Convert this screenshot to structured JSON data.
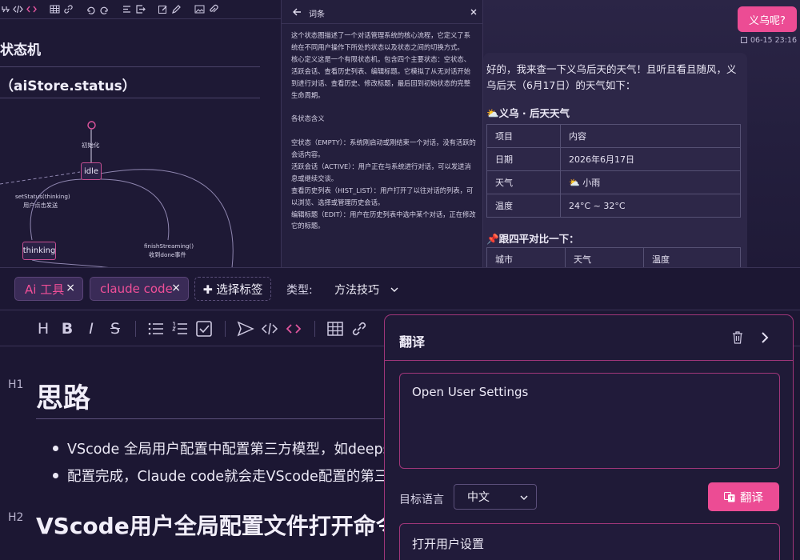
{
  "diagram": {
    "heading1": "状态机",
    "heading2": "（aiStore.status）",
    "nodes": {
      "init_label": "初始化",
      "idle": "idle",
      "thinking": "thinking",
      "edge1_line1": "setStatus(thinking)",
      "edge1_line2": "用户点击发送",
      "edge2_line1": "finishStreaming()",
      "edge2_line2": "收到done事件"
    },
    "toolbar_icons": [
      "code-icon",
      "code-brackets-icon",
      "table-icon",
      "link-icon",
      "undo-icon",
      "redo-icon",
      "align-icon",
      "export-icon",
      "edit-icon",
      "brush-icon",
      "image-icon",
      "attach-icon"
    ]
  },
  "glossary": {
    "title": "词条",
    "paragraphs": [
      "这个状态图描述了一个对话管理系统的核心流程，它定义了系统在不同用户操作下所处的状态以及状态之间的切换方式。",
      "核心定义这是一个有限状态机，包含四个主要状态：空状态、活跃会话、查看历史列表、编辑标题。它模拟了从无对话开始到进行对话、查看历史、修改标题，最后回到初始状态的完整生命周期。",
      "",
      "各状态含义",
      "",
      "空状态（EMPTY）：系统刚启动或刚结束一个对话，没有活跃的会话内容。",
      "活跃会话（ACTIVE）：用户正在与系统进行对话，可以发送消息或继续交谈。",
      "查看历史列表（HIST_LIST）：用户打开了以往对话的列表，可以浏览、选择或管理历史会话。",
      "编辑标题（EDIT）：用户在历史列表中选中某个对话，正在修改它的标题。"
    ]
  },
  "chat": {
    "user_message": "义乌呢?",
    "timestamp": "06-15 23:16",
    "reply_intro": "好的，我来查一下义乌后天的天气！且听且看且随风，义乌后天（6月17日）的天气如下：",
    "weather_heading": "义乌 · 后天天气",
    "weather_table": {
      "header": [
        "项目",
        "内容"
      ],
      "rows": [
        [
          "日期",
          "2026年6月17日"
        ],
        [
          "天气",
          "小雨"
        ],
        [
          "温度",
          "24°C ~ 32°C"
        ]
      ]
    },
    "compare_heading": "跟四平对比一下：",
    "compare_header": [
      "城市",
      "天气",
      "温度"
    ]
  },
  "editor": {
    "tags": [
      "Ai 工具",
      "claude code"
    ],
    "tag_remove": "×",
    "add_tag_label": "✚ 选择标签",
    "type_label": "类型:",
    "type_value": "方法技巧",
    "h1_marker": "H1",
    "h1_text": "思路",
    "bullets": [
      "VScode 全局用户配置中配置第三方模型，如deepseek",
      "配置完成，Claude code就会走VScode配置的第三方模型"
    ],
    "h2_marker": "H2",
    "h2_text": "VScode用户全局配置文件打开命令"
  },
  "translate": {
    "title": "翻译",
    "input_text": "Open User Settings",
    "target_label": "目标语言",
    "target_value": "中文",
    "button_label": "翻译",
    "output_text": "打开用户设置"
  }
}
